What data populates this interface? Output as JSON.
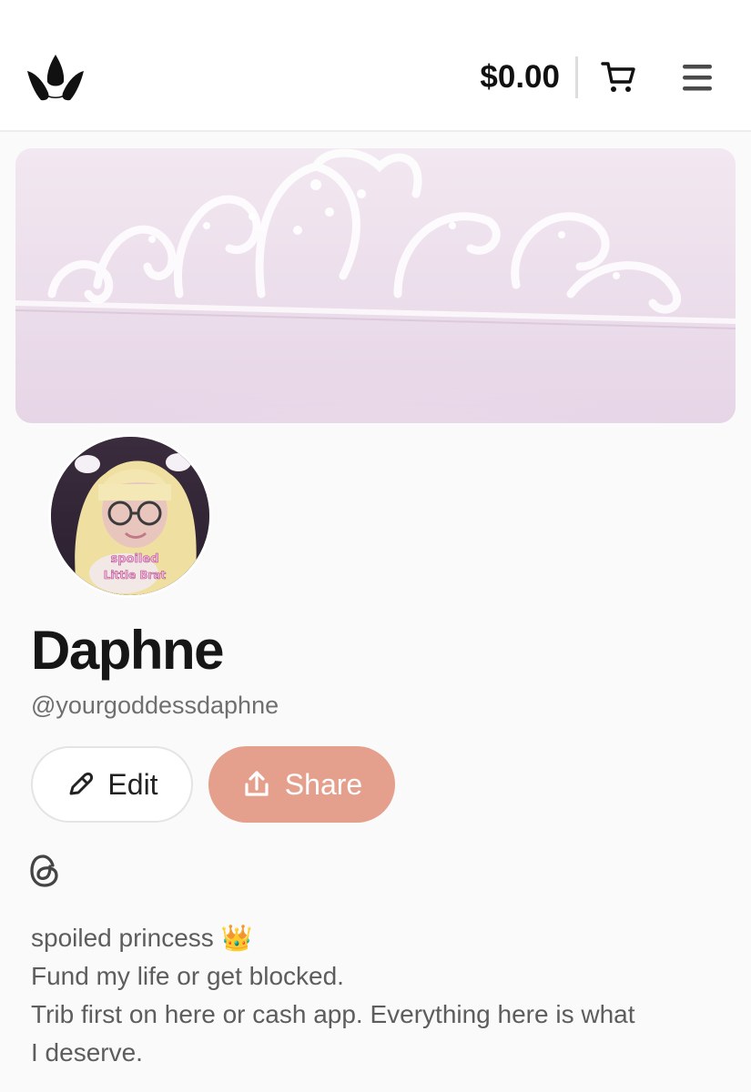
{
  "header": {
    "logo_icon": "crown-logo-icon",
    "cart_total": "$0.00",
    "cart_icon": "shopping-cart-icon",
    "menu_icon": "hamburger-menu-icon"
  },
  "banner": {
    "image": "tiara-banner-photo"
  },
  "profile": {
    "avatar": "profile-photo",
    "avatar_overlay_text": "spoiled Little Brat",
    "name": "Daphne",
    "handle": "@yourgoddessdaphne"
  },
  "actions": {
    "edit_label": "Edit",
    "edit_icon": "pencil-icon",
    "share_label": "Share",
    "share_icon": "share-upload-icon",
    "share_color": "#e4a08d"
  },
  "social": {
    "threads_icon": "threads-icon"
  },
  "bio": {
    "lines": [
      "spoiled princess 👑",
      "Fund my life or get blocked.",
      "Trib first on here or cash app. Everything here is what",
      "I deserve."
    ]
  }
}
